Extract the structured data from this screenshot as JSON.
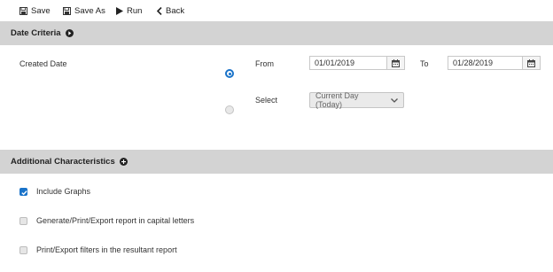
{
  "toolbar": {
    "save_label": "Save",
    "save_as_label": "Save As",
    "run_label": "Run",
    "back_label": "Back"
  },
  "date_criteria": {
    "title": "Date Criteria",
    "created_date_label": "Created Date",
    "from_label": "From",
    "from_value": "01/01/2019",
    "to_label": "To",
    "to_value": "01/28/2019",
    "select_label": "Select",
    "select_value": "Current Day (Today)",
    "range_option_selected": true,
    "select_option_selected": false
  },
  "additional": {
    "title": "Additional Characteristics",
    "options": [
      {
        "label": "Include Graphs",
        "checked": true
      },
      {
        "label": "Generate/Print/Export report in capital letters",
        "checked": false
      },
      {
        "label": "Print/Export filters in the resultant report",
        "checked": false
      }
    ]
  },
  "colors": {
    "accent": "#1a73c9",
    "header_bg": "#d3d3d3"
  },
  "icons": [
    "save-icon",
    "save-as-icon",
    "run-icon",
    "back-icon",
    "expand-icon",
    "calendar-icon",
    "chevron-down-icon"
  ]
}
